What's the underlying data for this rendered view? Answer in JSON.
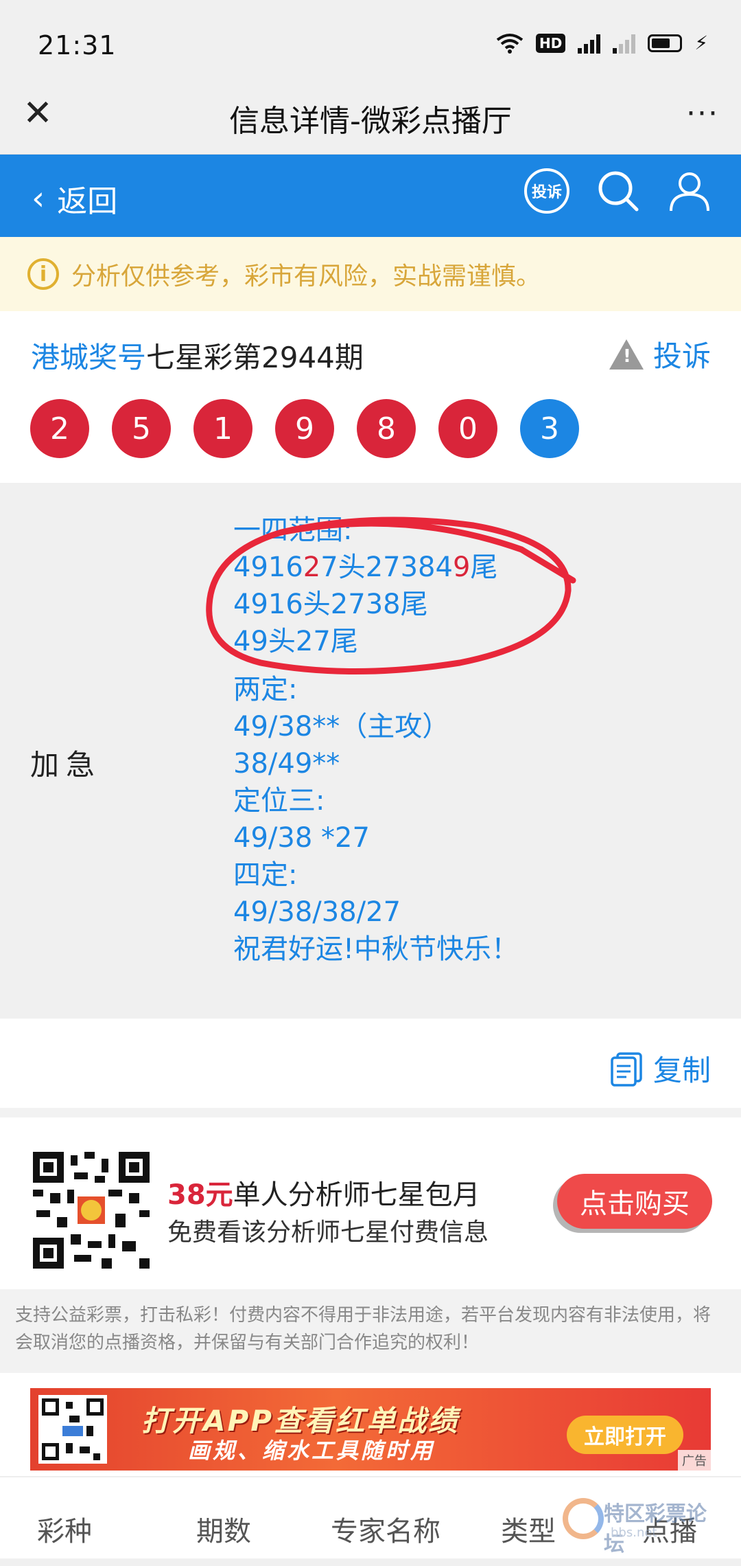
{
  "status_bar": {
    "time": "21:31",
    "hd": "HD",
    "network": "4G"
  },
  "title_bar": {
    "title": "信息详情-微彩点播厅",
    "more": "···"
  },
  "nav": {
    "back_label": "返回",
    "complain_badge": "投诉"
  },
  "notice": {
    "icon": "i",
    "text": "分析仅供参考，彩市有风险，实战需谨慎。"
  },
  "result": {
    "source": "港城奖号",
    "title_rest": "七星彩第2944期",
    "complain_label": "投诉",
    "balls": [
      "2",
      "5",
      "1",
      "9",
      "8",
      "0",
      "3"
    ]
  },
  "content": {
    "label": "加急",
    "lines": [
      "一四范围:",
      "491627头273849尾",
      "4916头2738尾",
      "49头27尾",
      "两定:",
      "49/38**（主攻）",
      "38/49**",
      "定位三:",
      "49/38 *27",
      "四定:",
      "49/38/38/27",
      "祝君好运!中秋节快乐！"
    ],
    "line2_parts": [
      "4916",
      "2",
      "7头27384",
      "9",
      "尾"
    ]
  },
  "copy": {
    "label": "复制"
  },
  "promo": {
    "price": "38元",
    "title": "单人分析师七星包月",
    "subtitle": "免费看该分析师七星付费信息",
    "buy_label": "点击购买"
  },
  "disclaimer": "支持公益彩票，打击私彩！付费内容不得用于非法用途，若平台发现内容有非法使用，将会取消您的点播资格，并保留与有关部门合作追究的权利！",
  "ad": {
    "line1": "打开APP查看红单战绩",
    "line2": "画规、缩水工具随时用",
    "button": "立即打开",
    "tag": "广告"
  },
  "table": {
    "headers": [
      "彩种",
      "期数",
      "专家名称",
      "类型",
      "点播"
    ]
  },
  "watermark": {
    "text": "特区彩票论坛",
    "sub": "bbs.net"
  },
  "colors": {
    "primary": "#1c86e3",
    "red": "#d9253a",
    "notice_bg": "#fdf8e1",
    "notice_text": "#d8a63a"
  }
}
